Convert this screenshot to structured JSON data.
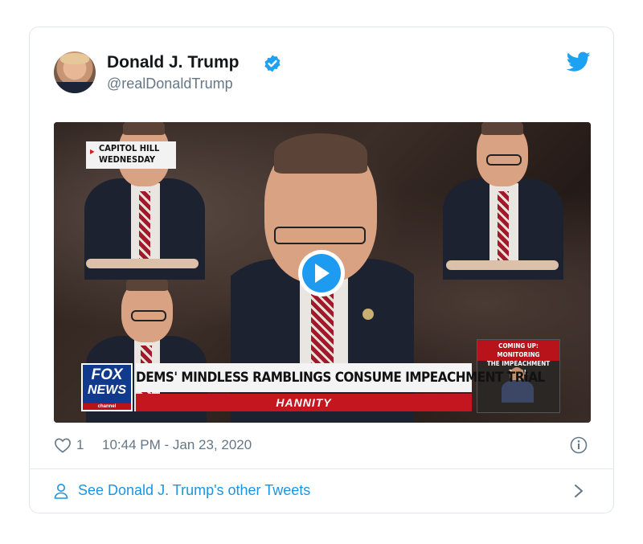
{
  "tweet": {
    "author_name": "Donald J. Trump",
    "author_handle": "@realDonaldTrump",
    "verified": true,
    "likes": "1",
    "timestamp": "10:44 PM - Jan 23, 2020",
    "footer_link": "See Donald J. Trump's other Tweets"
  },
  "video": {
    "location_caption_line1": "CAPITOL HILL",
    "location_caption_line2": "WEDNESDAY",
    "headline": "DEMS' MINDLESS RAMBLINGS CONSUME IMPEACHMENT TRIAL",
    "show_name": "HANNITY",
    "network_line1": "FOX",
    "network_line2": "NEWS",
    "network_line3": "channel",
    "coming_up_line1": "COMING UP: MONITORING",
    "coming_up_line2": "THE IMPEACHMENT TRIAL"
  },
  "icons": {
    "brand": "twitter-bird-icon",
    "verified": "verified-badge-icon",
    "play": "play-icon",
    "like": "heart-icon",
    "info": "info-icon",
    "user": "user-icon",
    "chevron": "chevron-right-icon"
  },
  "colors": {
    "twitter_blue": "#1da1f2",
    "link_blue": "#1b95e0",
    "muted_text": "#657786",
    "fox_red": "#c4161f",
    "fox_blue": "#123a8c"
  }
}
